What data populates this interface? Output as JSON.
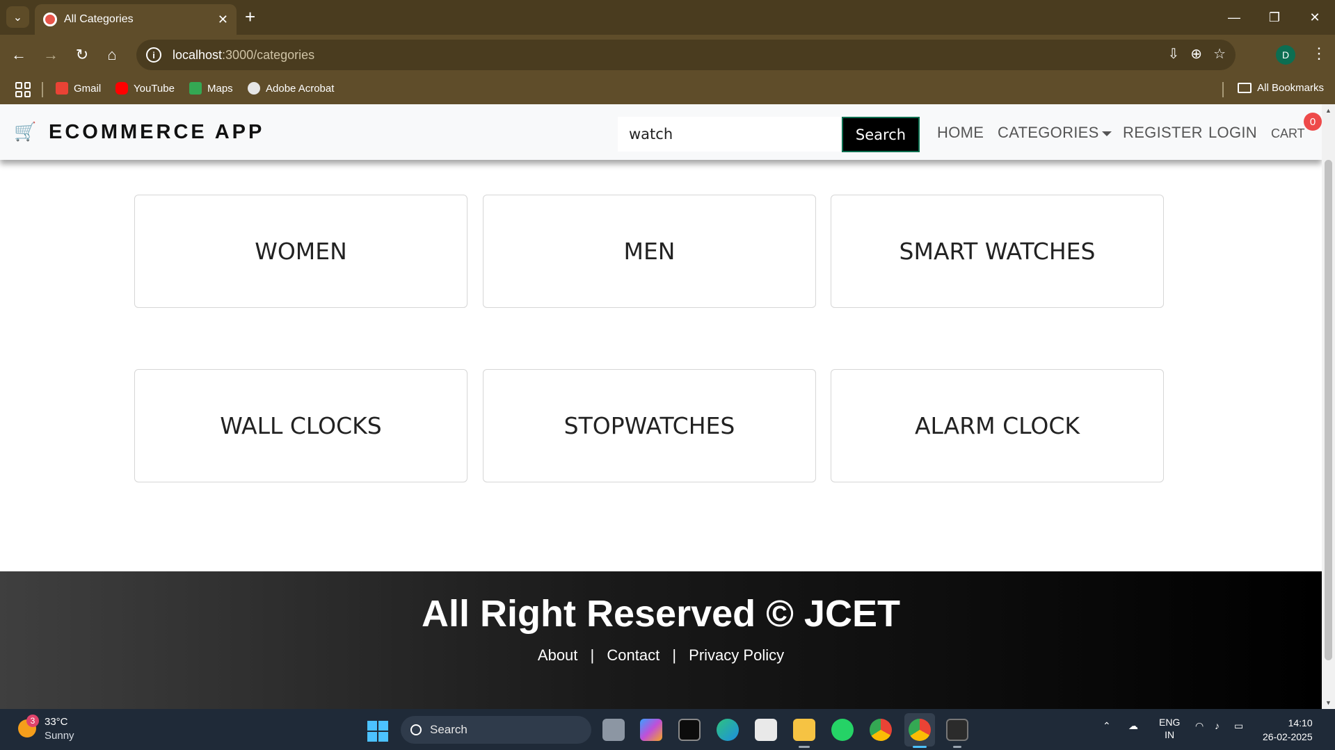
{
  "browser": {
    "tab_title": "All Categories",
    "tab_close": "✕",
    "new_tab": "+",
    "url_host": "localhost",
    "url_path": ":3000/categories",
    "profile_initial": "D",
    "window_controls": [
      "—",
      "❐",
      "✕"
    ],
    "bookmarks": [
      "Gmail",
      "YouTube",
      "Maps",
      "Adobe Acrobat"
    ],
    "all_bookmarks": "All Bookmarks"
  },
  "site": {
    "brand": "ECOMMERCE APP",
    "search": {
      "value": "watch",
      "button": "Search"
    },
    "nav": {
      "home": "HOME",
      "categories": "CATEGORIES",
      "register": "REGISTER",
      "login": "LOGIN",
      "cart": "CART",
      "cart_count": "0"
    },
    "categories": [
      "WOMEN",
      "MEN",
      "SMART WATCHES",
      "WALL CLOCKS",
      "STOPWATCHES",
      "ALARM CLOCK"
    ],
    "footer": {
      "title": "All Right Reserved © JCET",
      "links": [
        "About",
        "Contact",
        "Privacy Policy"
      ],
      "separator": "|"
    }
  },
  "taskbar": {
    "weather_temp": "33°C",
    "weather_desc": "Sunny",
    "weather_badge": "3",
    "search_placeholder": "Search",
    "lang_top": "ENG",
    "lang_bottom": "IN",
    "time": "14:10",
    "date": "26-02-2025"
  },
  "colors": {
    "chrome_frame": "#4a3c1f",
    "chrome_toolbar": "#5f4d2a",
    "navbar_bg": "#f8f9fa",
    "badge_red": "#ee4a4a",
    "search_btn_bg": "#000000",
    "taskbar_bg": "#1f2a38"
  }
}
